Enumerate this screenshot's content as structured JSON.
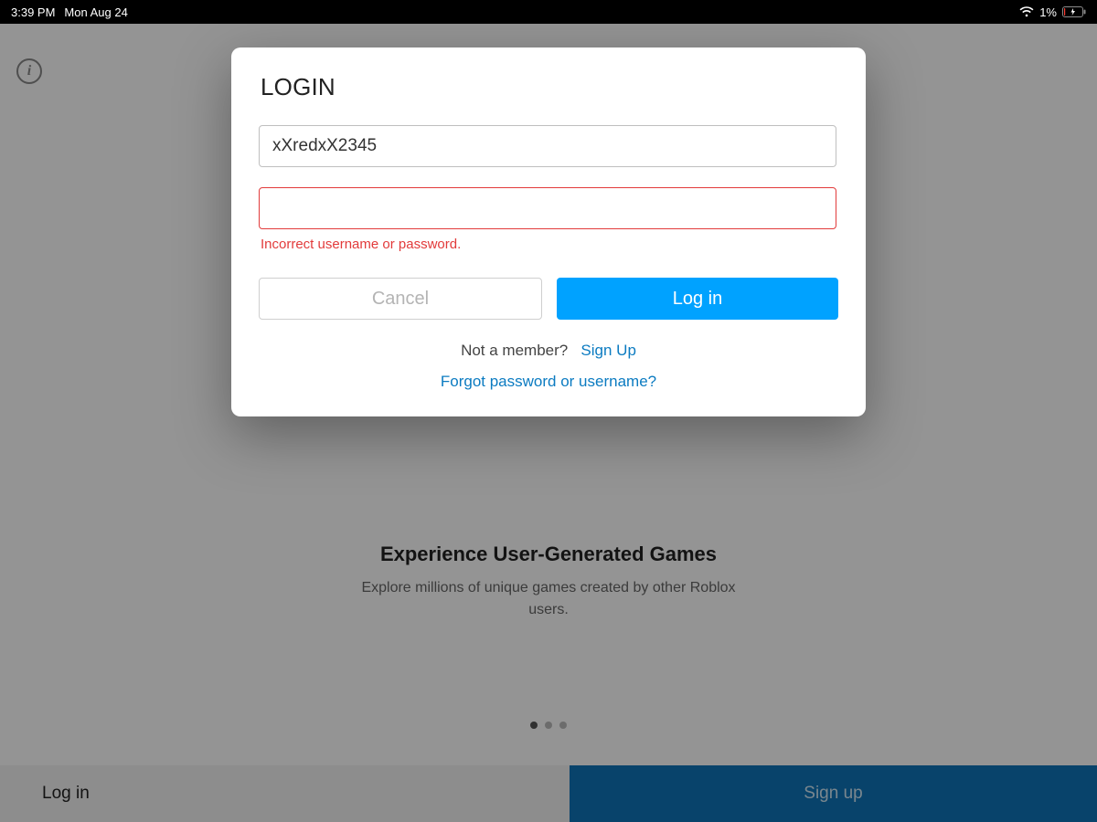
{
  "statusbar": {
    "time": "3:39 PM",
    "date": "Mon Aug 24",
    "battery_pct": "1%"
  },
  "landing": {
    "headline": "Experience User-Generated Games",
    "sub": "Explore millions of unique games created by other Roblox users."
  },
  "bottom_bar": {
    "login": "Log in",
    "signup": "Sign up"
  },
  "modal": {
    "title": "LOGIN",
    "username_value": "xXredxX2345",
    "password_value": "",
    "error_text": "Incorrect username or password.",
    "cancel_label": "Cancel",
    "login_label": "Log in",
    "not_member_text": "Not a member?",
    "signup_link": "Sign Up",
    "forgot_link": "Forgot password or username?"
  }
}
